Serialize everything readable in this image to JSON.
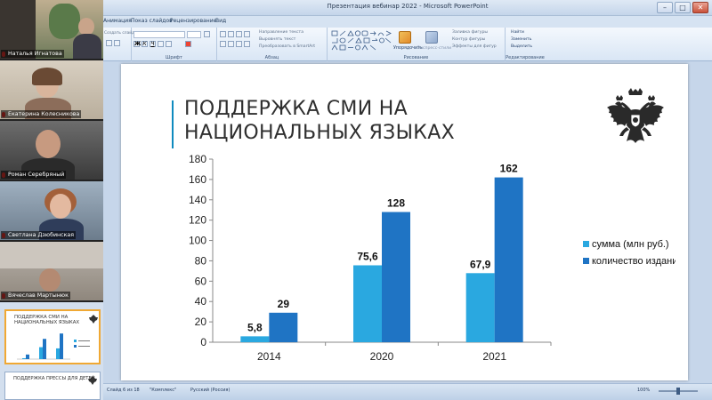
{
  "window": {
    "title": "Презентация вебинар 2022  -  Microsoft PowerPoint",
    "controls": [
      "–",
      "□",
      "✕"
    ]
  },
  "ribbon": {
    "tabs": [
      "Анимация",
      "Показ слайдов",
      "Рецензирование",
      "Вид"
    ],
    "groups": {
      "font_label": "Шрифт",
      "paragraph_label": "Абзац",
      "drawing_label": "Рисование",
      "editing_label": "Редактирование"
    },
    "items": {
      "clipboard_partial": "Создать слайд",
      "text_direction": "Направление текста",
      "align_text": "Выровнять текст",
      "convert_smartart": "Преобразовать в SmartArt",
      "arrange": "Упорядочить",
      "quick_styles": "Экспресс-стили",
      "shape_fill": "Заливка фигуры",
      "shape_outline": "Контур фигуры",
      "shape_effects": "Эффекты для фигур",
      "find": "Найти",
      "replace": "Заменить",
      "select": "Выделить"
    }
  },
  "slide": {
    "title_line1": "ПОДДЕРЖКА СМИ НА",
    "title_line2": "НАЦИОНАЛЬНЫХ ЯЗЫКАХ",
    "emblem_icon": "russian-coat-of-arms-icon"
  },
  "chart_data": {
    "type": "bar",
    "categories": [
      "2014",
      "2020",
      "2021"
    ],
    "series": [
      {
        "name": "сумма (млн руб.)",
        "values": [
          5.8,
          75.6,
          67.9
        ],
        "labels": [
          "5,8",
          "75,6",
          "67,9"
        ],
        "color": "#2aa8e0"
      },
      {
        "name": "количество изданий",
        "values": [
          29,
          128,
          162
        ],
        "labels": [
          "29",
          "128",
          "162"
        ],
        "color": "#1f74c4"
      }
    ],
    "ylim": [
      0,
      180
    ],
    "yticks": [
      0,
      20,
      40,
      60,
      80,
      100,
      120,
      140,
      160,
      180
    ],
    "grid": false,
    "legend_position": "right"
  },
  "status_bar": {
    "slide_info": "Слайд 6 из 18",
    "theme": "\"Комплекс\"",
    "language": "Русский (Россия)",
    "zoom": "100%"
  },
  "participants": [
    {
      "name": "Наталья Игнатова"
    },
    {
      "name": "Екатерина Колесникова"
    },
    {
      "name": "Роман Серебряный"
    },
    {
      "name": "Светлана Дзюбинская"
    },
    {
      "name": "Вячеслав Мартынюк"
    }
  ],
  "thumbnails": [
    {
      "title_line1": "ПОДДЕРЖКА СМИ НА",
      "title_line2": "НАЦИОНАЛЬНЫХ ЯЗЫКАХ",
      "selected": true
    },
    {
      "title_line1": "ПОДДЕРЖКА ПРЕССЫ ДЛЯ ДЕТЕЙ",
      "selected": false
    }
  ]
}
